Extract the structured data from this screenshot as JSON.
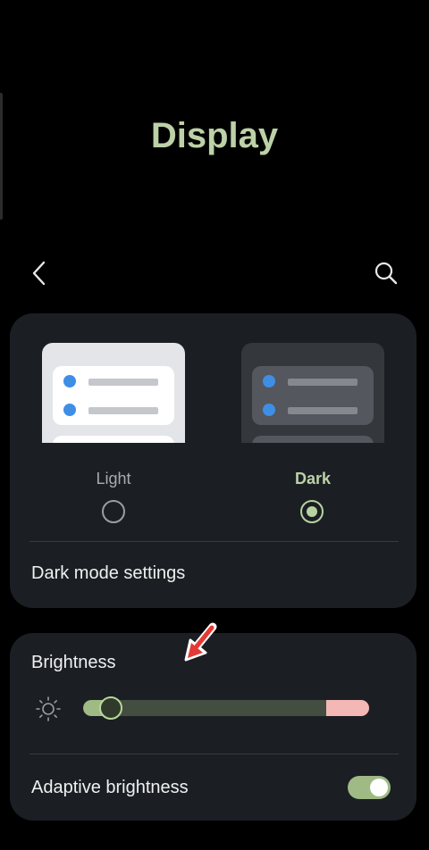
{
  "page": {
    "title": "Display"
  },
  "toolbar": {
    "back_icon": "chevron-left-icon",
    "search_icon": "search-icon"
  },
  "modes": {
    "light": {
      "label": "Light",
      "selected": false
    },
    "dark": {
      "label": "Dark",
      "selected": true
    }
  },
  "dark_mode_settings": {
    "label": "Dark mode settings"
  },
  "brightness": {
    "label": "Brightness",
    "icon": "sun-icon",
    "level": 0.06
  },
  "adaptive_brightness": {
    "label": "Adaptive brightness",
    "enabled": true
  },
  "colors": {
    "accent": "#bcd1a7",
    "track_fill": "#9fba84",
    "track_warning": "#f3b7b5",
    "card": "#1b1f24",
    "annotation_arrow": "#e53935"
  }
}
